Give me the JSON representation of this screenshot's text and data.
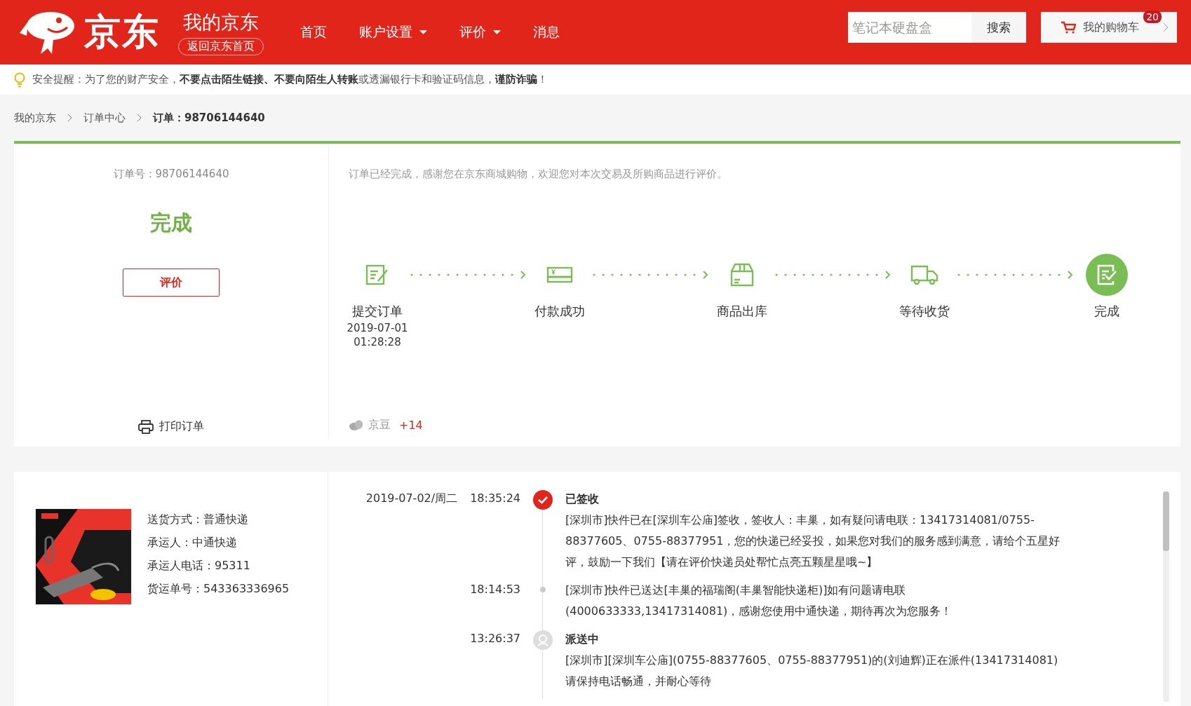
{
  "header": {
    "logo_text": "京东",
    "title": "我的京东",
    "home_link": "返回京东首页",
    "nav": [
      {
        "label": "首页",
        "dropdown": false
      },
      {
        "label": "账户设置",
        "dropdown": true
      },
      {
        "label": "评价",
        "dropdown": true
      },
      {
        "label": "消息",
        "dropdown": false
      }
    ],
    "search": {
      "placeholder": "笔记本硬盘盒",
      "button": "搜索"
    },
    "cart": {
      "label": "我的购物车",
      "badge": "20"
    }
  },
  "notice": {
    "text": "安全提醒：为了您的财产安全，**不要点击陌生链接、不要向陌生人转账**或透漏银行卡和验证码信息，**谨防诈骗**！"
  },
  "breadcrumb": [
    "我的京东",
    "订单中心",
    "订单：98706144640"
  ],
  "order": {
    "number": "订单号：98706144640",
    "status": "完成",
    "review_button": "评价",
    "print": "打印订单",
    "message": "订单已经完成，感谢您在京东商城购物，欢迎您对本次交易及所购商品进行评价。",
    "steps": [
      {
        "kind": "submit",
        "label": "提交订单",
        "date": "2019-07-01",
        "time": "01:28:28",
        "current": false
      },
      {
        "kind": "pay",
        "label": "付款成功",
        "current": false
      },
      {
        "kind": "box",
        "label": "商品出库",
        "current": false
      },
      {
        "kind": "truck",
        "label": "等待收货",
        "current": false
      },
      {
        "kind": "done",
        "label": "完成",
        "current": true
      }
    ],
    "beans": {
      "label": "京豆",
      "value": "+14"
    }
  },
  "shipping": {
    "product": {
      "kind": "picture"
    },
    "details": [
      "送货方式：普通快递",
      "承运人：中通快递",
      "承运人电话：95311",
      "货运单号：543363336965"
    ],
    "events": [
      {
        "date": "2019-07-02/周二",
        "time": "18:35:24",
        "kind": "check",
        "status": "已签收",
        "text": "[深圳市]快件已在[深圳车公庙]签收，签收人：丰巢，如有疑问请电联：13417314081/0755-88377605、0755-88377951，您的快递已经妥投，如果您对我们的服务感到满意，请给个五星好评，鼓励一下我们【请在评价快递员处帮忙点亮五颗星星哦~】"
      },
      {
        "time": "18:14:53",
        "kind": "dot",
        "text": "[深圳市]快件已送达[丰巢的福瑞阁(丰巢智能快递柜)]如有问题请电联(4000633333,13417314081)，感谢您使用中通快递，期待再次为您服务！"
      },
      {
        "time": "13:26:37",
        "kind": "courier",
        "status": "派送中",
        "text": "[深圳市][深圳车公庙](0755-88377605、0755-88377951)的(刘迪辉)正在派件(13417314081)请保持电话畅通，并耐心等待"
      }
    ]
  }
}
